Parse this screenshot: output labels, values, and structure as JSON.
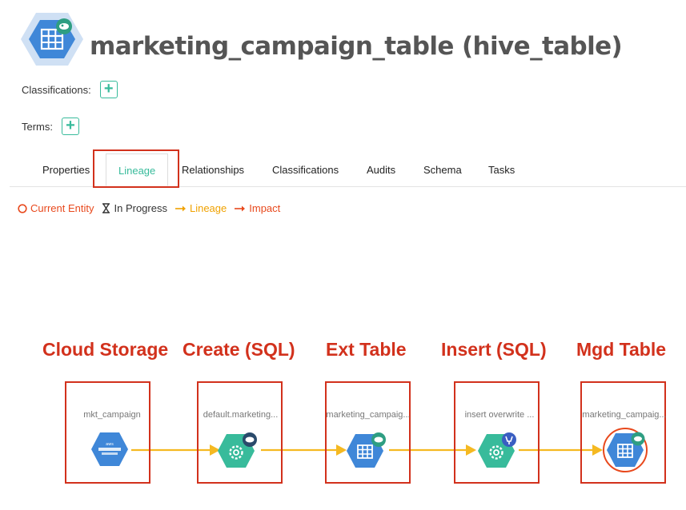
{
  "header": {
    "title": "marketing_campaign_table (hive_table)",
    "icon": "hive-table-hexagon-icon"
  },
  "classifications": {
    "label": "Classifications:",
    "add": "+"
  },
  "terms": {
    "label": "Terms:",
    "add": "+"
  },
  "tabs": [
    {
      "label": "Properties"
    },
    {
      "label": "Lineage",
      "active": true
    },
    {
      "label": "Relationships"
    },
    {
      "label": "Classifications"
    },
    {
      "label": "Audits"
    },
    {
      "label": "Schema"
    },
    {
      "label": "Tasks"
    }
  ],
  "legend": {
    "current": "Current Entity",
    "progress": "In Progress",
    "lineage": "Lineage",
    "impact": "Impact"
  },
  "lineage": {
    "nodes": [
      {
        "stage": "Cloud Storage",
        "name": "mkt_campaign",
        "icon": "cloud-storage-icon"
      },
      {
        "stage": "Create (SQL)",
        "name": "default.marketing...",
        "icon": "process-gear-icon"
      },
      {
        "stage": "Ext Table",
        "name": "marketing_campaig...",
        "icon": "table-icon"
      },
      {
        "stage": "Insert (SQL)",
        "name": "insert overwrite ...",
        "icon": "process-gear-icon"
      },
      {
        "stage": "Mgd Table",
        "name": "marketing_campaig...",
        "icon": "table-icon",
        "current": true
      }
    ]
  },
  "colors": {
    "accent": "#38bb9b",
    "lineage_arrow": "#f5b921",
    "impact": "#e8491d",
    "annotation": "#d2311c",
    "table_blue": "#3f87d8"
  }
}
